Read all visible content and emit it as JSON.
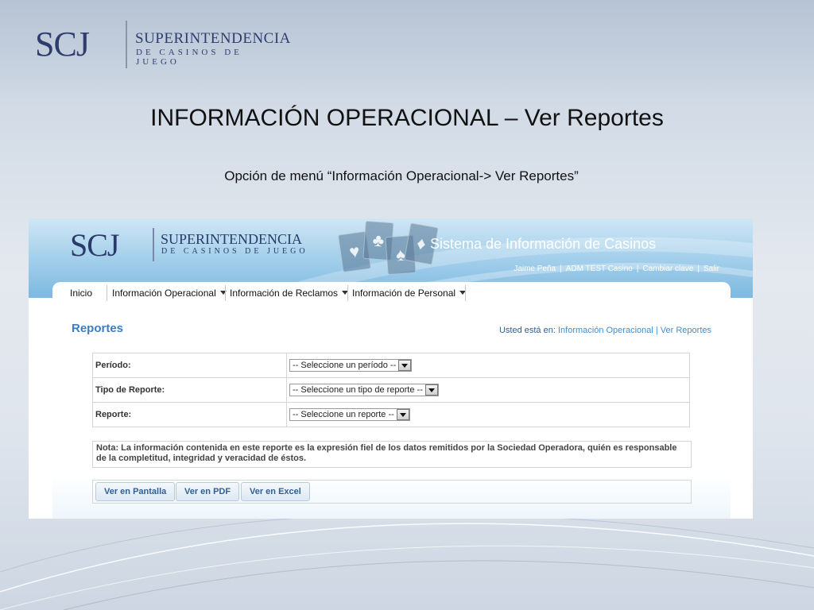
{
  "slide": {
    "logo": {
      "abbr": "SCJ",
      "line1": "SUPERINTENDENCIA",
      "line2": "DE CASINOS DE JUEGO"
    },
    "title": "INFORMACIÓN OPERACIONAL – Ver Reportes",
    "subtitle": "Opción de menú “Información Operacional-> Ver Reportes”"
  },
  "app": {
    "logo": {
      "abbr": "SCJ",
      "line1": "SUPERINTENDENCIA",
      "line2": "DE CASINOS DE JUEGO"
    },
    "system_name": "Sistema de Información de Casinos",
    "user_links": {
      "user": "Jaime Peña",
      "casino": "ADM TEST Casino",
      "change_password": "Cambiar clave",
      "logout": "Salir"
    },
    "nav": {
      "inicio": "Inicio",
      "operacional": "Información Operacional",
      "reclamos": "Información de Reclamos",
      "personal": "Información de Personal"
    },
    "page_title": "Reportes",
    "breadcrumb": {
      "prefix": "Usted está en:",
      "section": "Información Operacional",
      "separator": "|",
      "page": "Ver Reportes"
    },
    "form": {
      "periodo_label": "Período:",
      "periodo_value": "-- Seleccione un período --",
      "tipo_label": "Tipo de Reporte:",
      "tipo_value": "-- Seleccione un tipo de reporte --",
      "reporte_label": "Reporte:",
      "reporte_value": "-- Seleccione un reporte --"
    },
    "note": "Nota: La información contenida en este reporte es la expresión fiel de los datos remitidos por la Sociedad Operadora, quién es responsable de la completitud, integridad y veracidad de éstos.",
    "buttons": {
      "screen": "Ver en Pantalla",
      "pdf": "Ver en PDF",
      "excel": "Ver en Excel"
    },
    "icons": [
      "cards-decoration-icon",
      "caret-down-icon",
      "select-arrow-icon"
    ]
  }
}
